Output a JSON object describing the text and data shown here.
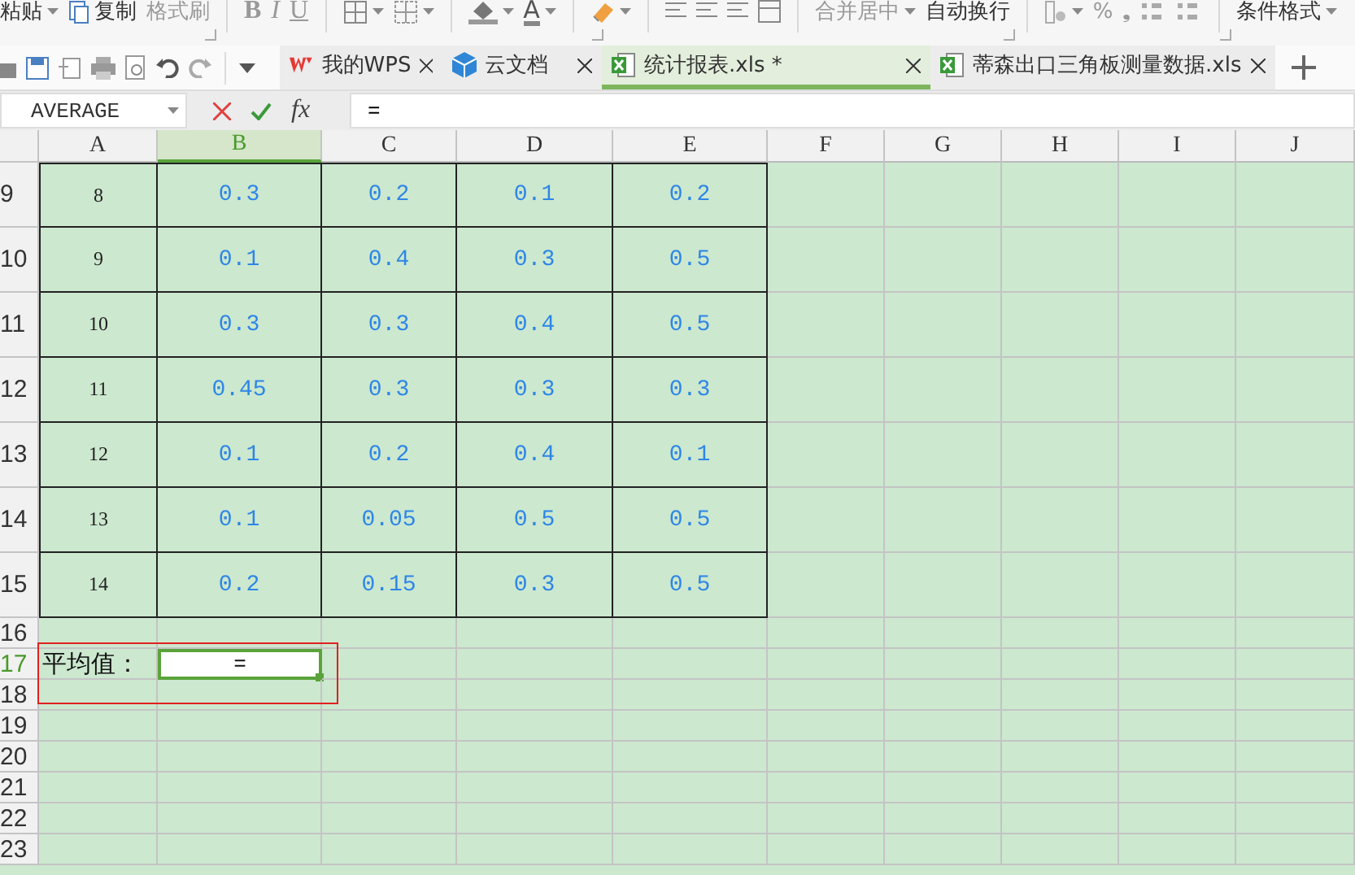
{
  "ribbon": {
    "items": [
      {
        "kind": "text",
        "text": "粘贴",
        "caret": true
      },
      {
        "kind": "copy",
        "text": "复制"
      },
      {
        "kind": "text",
        "text": "格式刷",
        "faded": true
      },
      {
        "kind": "divider"
      },
      {
        "kind": "bold",
        "text": "B"
      },
      {
        "kind": "italic",
        "text": "I"
      },
      {
        "kind": "underline",
        "text": "U"
      },
      {
        "kind": "divider"
      },
      {
        "kind": "borders",
        "caret": true
      },
      {
        "kind": "pattern",
        "caret": true
      },
      {
        "kind": "divider"
      },
      {
        "kind": "fill",
        "caret": true
      },
      {
        "kind": "fontcolor",
        "text": "A",
        "caret": true
      },
      {
        "kind": "divider"
      },
      {
        "kind": "eraser",
        "caret": true
      },
      {
        "kind": "divider"
      },
      {
        "kind": "align"
      },
      {
        "kind": "align"
      },
      {
        "kind": "align"
      },
      {
        "kind": "merge"
      },
      {
        "kind": "divider"
      },
      {
        "kind": "text",
        "text": "合并居中",
        "caret": true,
        "faded": true
      },
      {
        "kind": "text",
        "text": "自动换行"
      },
      {
        "kind": "divider"
      },
      {
        "kind": "numfmt",
        "caret": true
      },
      {
        "kind": "text",
        "text": "%",
        "faded": true
      },
      {
        "kind": "text",
        "text": "❟",
        "faded": true
      },
      {
        "kind": "decimals"
      },
      {
        "kind": "decimals"
      },
      {
        "kind": "divider"
      },
      {
        "kind": "text",
        "text": "条件格式",
        "caret": true
      }
    ]
  },
  "tabs": [
    {
      "label": "我的WPS",
      "kind": "wps",
      "selected": false
    },
    {
      "label": "云文档",
      "kind": "cloud",
      "selected": false
    },
    {
      "label": "统计报表.xls *",
      "kind": "sheet",
      "selected": true
    },
    {
      "label": "蒂森出口三角板测量数据.xls",
      "kind": "sheet",
      "selected": false
    }
  ],
  "formula_bar": {
    "name_box": "AVERAGE",
    "function_button": "fx",
    "formula": "="
  },
  "sheet": {
    "columns": [
      {
        "label": "A",
        "selected": false
      },
      {
        "label": "B",
        "selected": true
      },
      {
        "label": "C",
        "selected": false
      },
      {
        "label": "D",
        "selected": false
      },
      {
        "label": "E",
        "selected": false
      },
      {
        "label": "F",
        "selected": false
      },
      {
        "label": "G",
        "selected": false
      },
      {
        "label": "H",
        "selected": false
      },
      {
        "label": "I",
        "selected": false
      },
      {
        "label": "J",
        "selected": false
      }
    ],
    "rows": [
      {
        "number": "9",
        "kind": "data",
        "selected": false,
        "cells": [
          "8",
          "0.3",
          "0.2",
          "0.1",
          "0.2"
        ]
      },
      {
        "number": "10",
        "kind": "data",
        "selected": false,
        "cells": [
          "9",
          "0.1",
          "0.4",
          "0.3",
          "0.5"
        ]
      },
      {
        "number": "11",
        "kind": "data",
        "selected": false,
        "cells": [
          "10",
          "0.3",
          "0.3",
          "0.4",
          "0.5"
        ]
      },
      {
        "number": "12",
        "kind": "data",
        "selected": false,
        "cells": [
          "11",
          "0.45",
          "0.3",
          "0.3",
          "0.3"
        ]
      },
      {
        "number": "13",
        "kind": "data",
        "selected": false,
        "cells": [
          "12",
          "0.1",
          "0.2",
          "0.4",
          "0.1"
        ]
      },
      {
        "number": "14",
        "kind": "data",
        "selected": false,
        "cells": [
          "13",
          "0.1",
          "0.05",
          "0.5",
          "0.5"
        ]
      },
      {
        "number": "15",
        "kind": "data",
        "selected": false,
        "cells": [
          "14",
          "0.2",
          "0.15",
          "0.3",
          "0.5"
        ]
      },
      {
        "number": "16",
        "kind": "plain",
        "selected": false
      },
      {
        "number": "17",
        "kind": "plain",
        "selected": true,
        "cells": [
          "平均值：",
          "="
        ]
      },
      {
        "number": "18",
        "kind": "plain",
        "selected": false
      },
      {
        "number": "19",
        "kind": "plain",
        "selected": false
      },
      {
        "number": "20",
        "kind": "plain",
        "selected": false
      },
      {
        "number": "21",
        "kind": "plain",
        "selected": false
      },
      {
        "number": "22",
        "kind": "plain",
        "selected": false
      },
      {
        "number": "23",
        "kind": "plain",
        "selected": false
      }
    ]
  }
}
